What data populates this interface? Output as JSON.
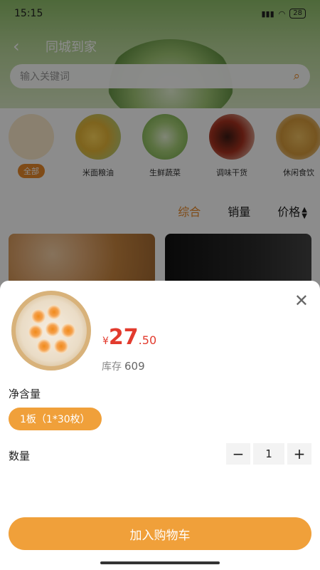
{
  "status": {
    "time": "15:15",
    "battery": "28"
  },
  "nav": {
    "title": "同城到家"
  },
  "search": {
    "placeholder": "输入关键词",
    "icon": "search-icon"
  },
  "categories": [
    {
      "label": "全部"
    },
    {
      "label": "米面粮油"
    },
    {
      "label": "生鲜蔬菜"
    },
    {
      "label": "调味干货"
    },
    {
      "label": "休闲食饮"
    }
  ],
  "sort": {
    "comprehensive": "综合",
    "sales": "销量",
    "price": "价格"
  },
  "sheet": {
    "price_symbol": "¥",
    "price_int": "27",
    "price_dec": ".50",
    "stock_label": "库存",
    "stock_value": "609",
    "size_label": "净含量",
    "spec_option": "1板（1*30枚）",
    "qty_label": "数量",
    "qty_minus": "−",
    "qty_value": "1",
    "qty_plus": "+",
    "add_to_cart": "加入购物车"
  },
  "colors": {
    "accent": "#f0a03a",
    "price": "#e23b2e"
  }
}
